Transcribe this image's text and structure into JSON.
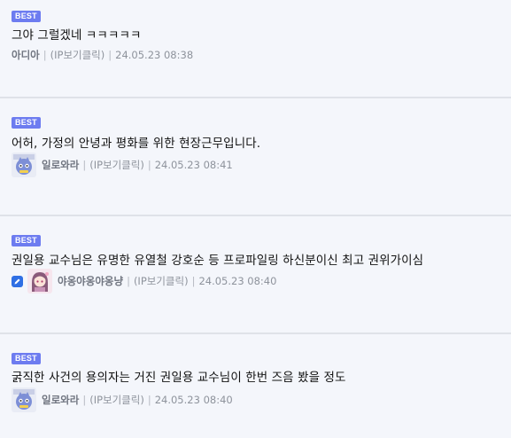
{
  "comments": [
    {
      "badge": "BEST",
      "text": "그야 그럴겠네 ㅋㅋㅋㅋㅋ",
      "nick": "아디아",
      "ip": "(IP보기클릭)",
      "time": "24.05.23 08:38",
      "avatar": "none"
    },
    {
      "badge": "BEST",
      "text": "어허, 가정의 안녕과 평화를 위한 현장근무입니다.",
      "nick": "일로와라",
      "ip": "(IP보기클릭)",
      "time": "24.05.23 08:41",
      "avatar": "cat-avatar"
    },
    {
      "badge": "BEST",
      "text": "권일용 교수님은 유명한 유열철 강호순 등 프로파일링 하신분이신 최고 권위가이심",
      "nick": "야옹야옹야옹냥",
      "ip": "(IP보기클릭)",
      "time": "24.05.23 08:40",
      "avatar": "anime-girl-avatar"
    },
    {
      "badge": "BEST",
      "text": "굵직한 사건의 용의자는 거진 권일용 교수님이 한번 즈음 봤을 정도",
      "nick": "일로와라",
      "ip": "(IP보기클릭)",
      "time": "24.05.23 08:40",
      "avatar": "cat-avatar"
    }
  ],
  "colors": {
    "background": "#f4f6fb",
    "badge": "#6d7cf0",
    "divider": "#dfe2e8",
    "text": "#111111",
    "meta": "#8e939c",
    "pencil": "#2f6fe4"
  }
}
